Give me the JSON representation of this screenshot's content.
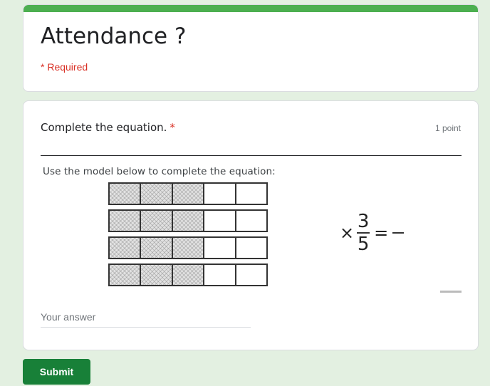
{
  "form": {
    "title": "Attendance ?",
    "required_note": "* Required",
    "accent_color": "#4caf50",
    "submit_label": "Submit",
    "submit_color": "#188038"
  },
  "question": {
    "title": "Complete the equation.",
    "required_marker": "*",
    "points": "1 point",
    "image": {
      "instruction": "Use the model below to complete the equation:",
      "model": {
        "rows": 4,
        "cells_per_row": 5,
        "shaded_per_row": 3
      },
      "equation": {
        "operator": "×",
        "numerator": "3",
        "denominator": "5",
        "equals": "="
      }
    },
    "answer_placeholder": "Your answer"
  }
}
